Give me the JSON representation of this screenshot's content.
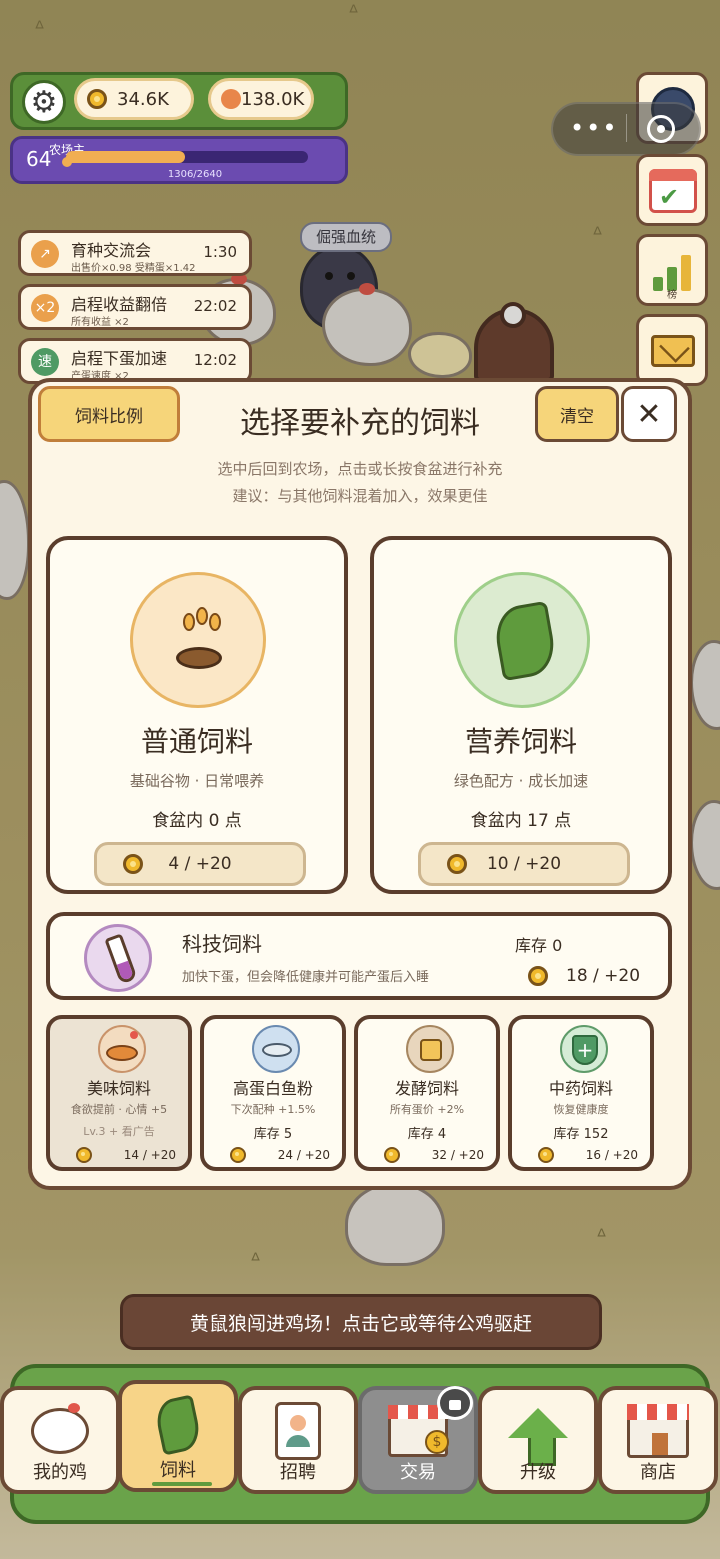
{
  "hud": {
    "coins": "34.6K",
    "gems": "138.0K",
    "level": "64",
    "title": "农场主",
    "xp_text": "1306/2640",
    "xp_progress": 0.49
  },
  "scene": {
    "trait_tag": "倔强血统"
  },
  "buffs": [
    {
      "icon": "↗",
      "name": "育种交流会",
      "sub": "出售价×0.98 受精蛋×1.42",
      "time": "1:30"
    },
    {
      "icon": "×2",
      "name": "启程收益翻倍",
      "sub": "所有收益 ×2",
      "time": "22:02"
    },
    {
      "icon": "速",
      "name": "启程下蛋加速",
      "sub": "产蛋速度 ×2",
      "time": "12:02"
    }
  ],
  "side": {
    "rank_label": "榜"
  },
  "modal": {
    "ratio_button": "饲料比例",
    "title": "选择要补充的饲料",
    "clear_button": "清空",
    "close_button": "✕",
    "subtitle1": "选中后回到农场，点击或长按食盆进行补充",
    "subtitle2": "建议：与其他饲料混着加入，效果更佳",
    "feeds": [
      {
        "name": "普通饲料",
        "desc": "基础谷物 · 日常喂养",
        "count": "食盆内 0 点",
        "cost": "4 / +20"
      },
      {
        "name": "营养饲料",
        "desc": "绿色配方 · 成长加速",
        "count": "食盆内 17 点",
        "cost": "10 / +20"
      }
    ],
    "tech": {
      "name": "科技饲料",
      "desc": "加快下蛋，但会降低健康并可能产蛋后入睡",
      "stock": "库存 0",
      "cost": "18 / +20"
    },
    "small": [
      {
        "name": "美味饲料",
        "desc": "食欲提前 · 心情 +5",
        "extra": "Lv.3 + 看广告",
        "cost": "14 / +20"
      },
      {
        "name": "高蛋白鱼粉",
        "desc": "下次配种 +1.5%",
        "stock": "库存 5",
        "cost": "24 / +20"
      },
      {
        "name": "发酵饲料",
        "desc": "所有蛋价 +2%",
        "stock": "库存 4",
        "cost": "32 / +20"
      },
      {
        "name": "中药饲料",
        "desc": "恢复健康度",
        "stock": "库存 152",
        "cost": "16 / +20"
      }
    ]
  },
  "toast": "黄鼠狼闯进鸡场！点击它或等待公鸡驱赶",
  "nav": [
    {
      "label": "我的鸡"
    },
    {
      "label": "饲料"
    },
    {
      "label": "招聘"
    },
    {
      "label": "交易"
    },
    {
      "label": "升级"
    },
    {
      "label": "商店"
    }
  ],
  "colors": {
    "accent_yellow": "#f6d57a",
    "frame_brown": "#6b4a35",
    "hud_green": "#5b8f3a",
    "level_purple": "#6b4bb0"
  }
}
